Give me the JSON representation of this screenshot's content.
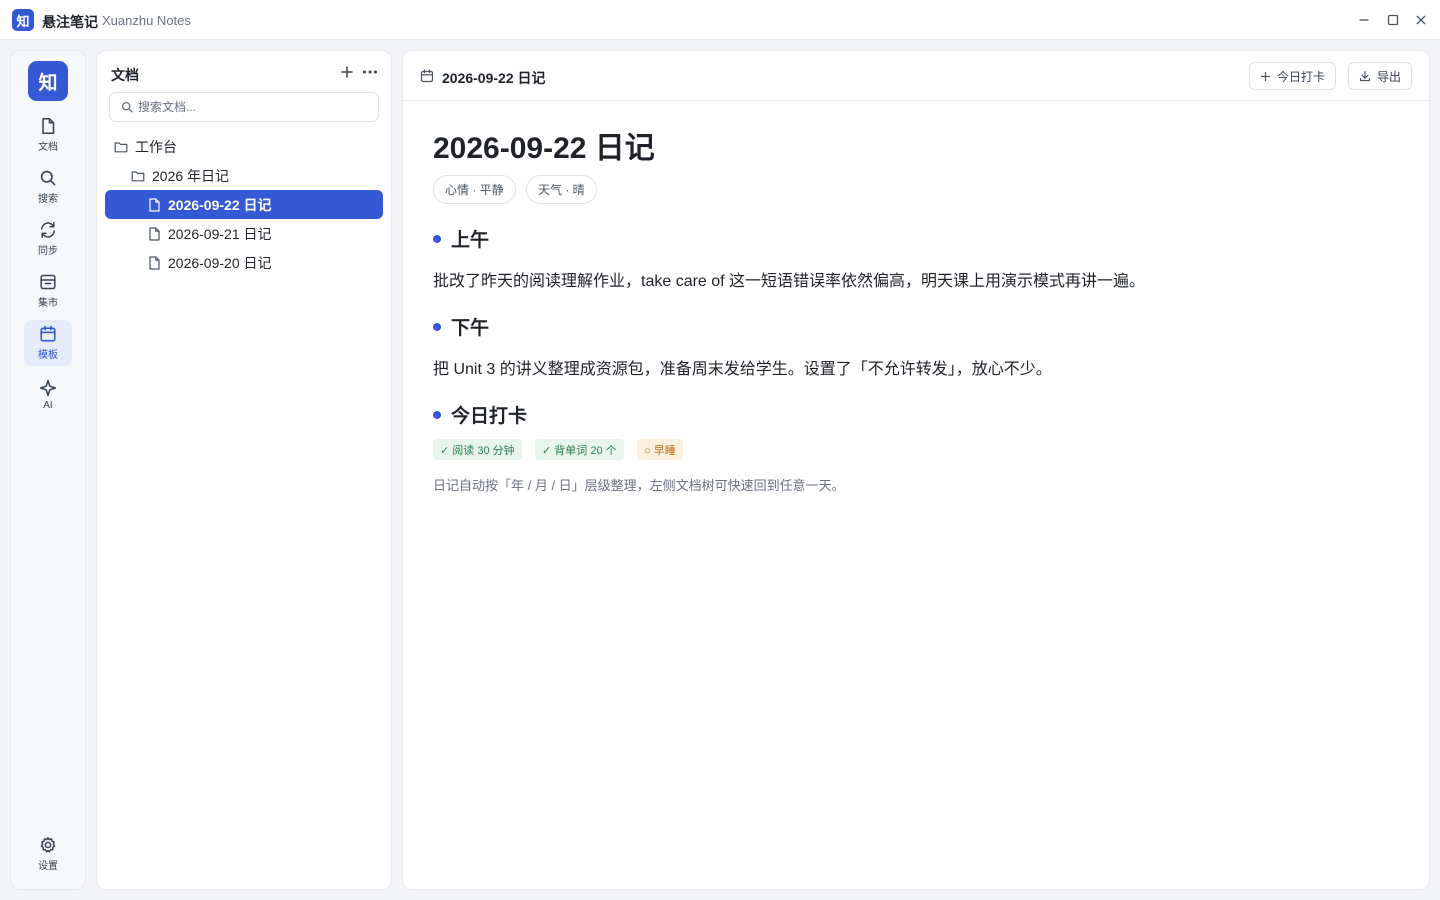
{
  "app": {
    "logo_glyph": "知",
    "name": "悬注笔记",
    "subtitle": "Xuanzhu Notes",
    "accent": "#3558d4"
  },
  "window": {
    "minimize_icon": "minimize-icon",
    "maximize_icon": "maximize-icon",
    "close_icon": "close-icon"
  },
  "rail": {
    "logo_glyph": "知",
    "items": [
      {
        "label": "文档",
        "icon": "file-icon",
        "active": false
      },
      {
        "label": "搜索",
        "icon": "search-icon",
        "active": false
      },
      {
        "label": "同步",
        "icon": "sync-icon",
        "active": false
      },
      {
        "label": "集市",
        "icon": "market-icon",
        "active": false
      },
      {
        "label": "模板",
        "icon": "calendar-icon",
        "active": true
      },
      {
        "label": "AI",
        "icon": "sparkle-icon",
        "active": false
      }
    ],
    "settings": {
      "label": "设置",
      "icon": "gear-icon"
    }
  },
  "tree": {
    "title": "文档",
    "search_placeholder": "搜索文档...",
    "nodes": [
      {
        "label": "工作台",
        "type": "folder",
        "level": 0,
        "active": false
      },
      {
        "label": "2026 年日记",
        "type": "folder",
        "level": 1,
        "active": false
      },
      {
        "label": "2026-09-22 日记",
        "type": "file",
        "level": 2,
        "active": true
      },
      {
        "label": "2026-09-21 日记",
        "type": "file",
        "level": 2,
        "active": false
      },
      {
        "label": "2026-09-20 日记",
        "type": "file",
        "level": 2,
        "active": false
      }
    ]
  },
  "editor": {
    "header_title": "2026-09-22 日记",
    "checkin_button": "今日打卡",
    "export_button": "导出",
    "doc_title": "2026-09-22 日记",
    "tags": [
      "心情 · 平静",
      "天气 · 晴"
    ],
    "sections": [
      {
        "heading": "上午",
        "body": "批改了昨天的阅读理解作业，take care of 这一短语错误率依然偏高，明天课上用演示模式再讲一遍。"
      },
      {
        "heading": "下午",
        "body": "把 Unit 3 的讲义整理成资源包，准备周末发给学生。设置了「不允许转发」，放心不少。"
      },
      {
        "heading": "今日打卡",
        "body": ""
      }
    ],
    "checklist": [
      {
        "label": "✓ 阅读 30 分钟",
        "done": true
      },
      {
        "label": "✓ 背单词 20 个",
        "done": true
      },
      {
        "label": "○ 早睡",
        "done": false
      }
    ],
    "note": "日记自动按「年 / 月 / 日」层级整理，左侧文档树可快速回到任意一天。"
  }
}
